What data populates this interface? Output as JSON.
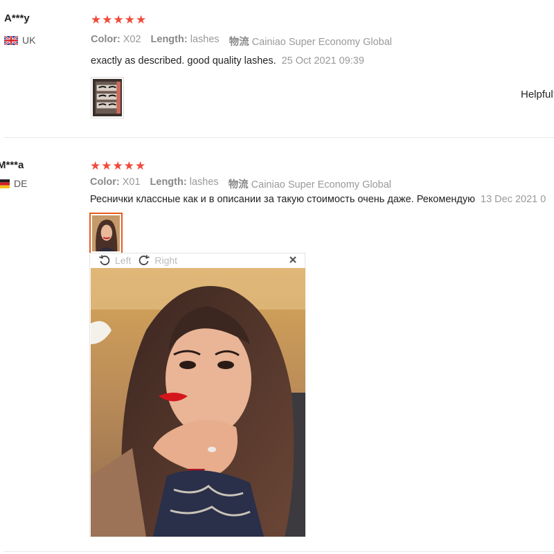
{
  "reviews": [
    {
      "username": "A***y",
      "country": "UK",
      "flag_icon": "uk-flag-icon",
      "rating": 5,
      "attributes": {
        "color_label": "Color:",
        "color_value": "X02",
        "length_label": "Length:",
        "length_value": "lashes",
        "shipping_label": "物流",
        "shipping_value": "Cainiao Super Economy Global"
      },
      "text": "exactly as described. good quality lashes.",
      "date": "25 Oct 2021 09:39",
      "helpful_label": "Helpful?"
    },
    {
      "username": "M***a",
      "country": "DE",
      "flag_icon": "de-flag-icon",
      "rating": 5,
      "attributes": {
        "color_label": "Color:",
        "color_value": "X01",
        "length_label": "Length:",
        "length_value": "lashes",
        "shipping_label": "物流",
        "shipping_value": "Cainiao Super Economy Global"
      },
      "text": "Реснички классные как и в описании за такую стоимость очень даже. Рекомендую",
      "date": "13 Dec 2021 0"
    }
  ],
  "viewer": {
    "rotate_left_label": "Left",
    "rotate_right_label": "Right",
    "close_icon": "close-icon"
  },
  "colors": {
    "star": "#f04a3a",
    "active_thumb_border": "#e85a1a",
    "muted_text": "#999999"
  }
}
